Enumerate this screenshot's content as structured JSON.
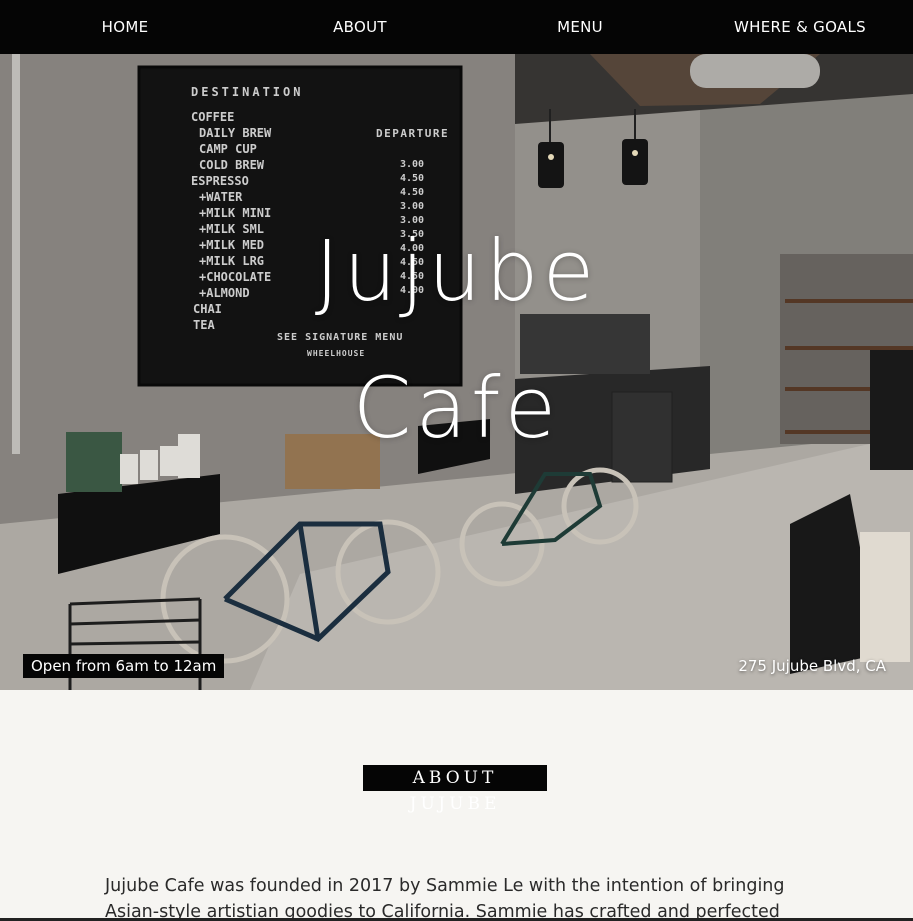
{
  "nav": {
    "items": [
      "HOME",
      "ABOUT",
      "MENU",
      "WHERE & GOALS"
    ]
  },
  "hero": {
    "title_line1": "Jujube",
    "title_line2": "Cafe",
    "hours": "Open from 6am to 12am",
    "address": "275 Jujube Blvd, CA",
    "menu_board": {
      "header_left": "DESTINATION",
      "header_right": "DEPARTURE",
      "items": [
        "COFFEE",
        "DAILY BREW",
        "CAMP CUP",
        "COLD BREW",
        "ESPRESSO",
        "+WATER",
        "+MILK MINI",
        "+MILK SML",
        "+MILK MED",
        "+MILK LRG",
        "+CHOCOLATE",
        "+ALMOND",
        "CHAI",
        "TEA"
      ],
      "prices": [
        "3.00",
        "4.50",
        "4.50",
        "3.00",
        "3.00",
        "3.50",
        "4.00",
        "4.50",
        "4.50",
        "4.00"
      ],
      "footer": "SEE SIGNATURE MENU",
      "brand": "WHEELHOUSE"
    }
  },
  "about": {
    "heading": "ABOUT JUJUBE",
    "text": "Jujube Cafe was founded in 2017 by Sammie Le with the intention of bringing Asian-style artistian goodies to California. Sammie has crafted and perfected"
  },
  "colors": {
    "nav_bg": "#050505",
    "page_bg": "#f6f5f2",
    "accent_text": "#ffffff"
  }
}
